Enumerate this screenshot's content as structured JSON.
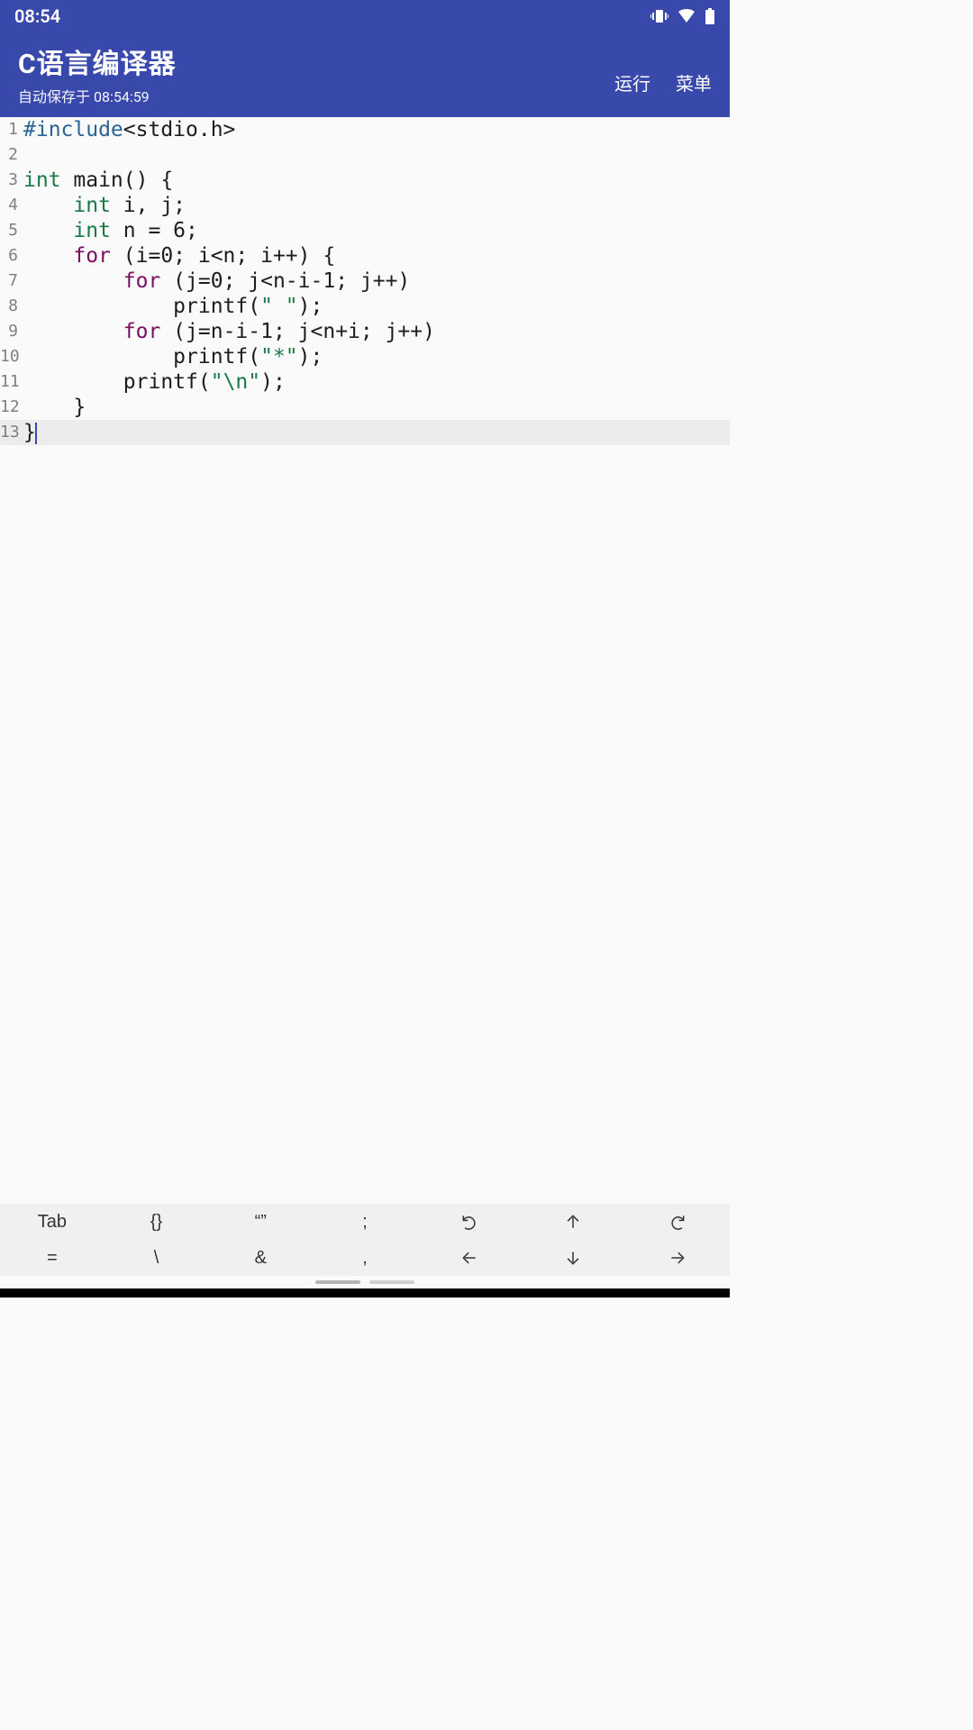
{
  "status": {
    "time": "08:54",
    "icons": [
      "vibrate-icon",
      "wifi-icon",
      "battery-icon"
    ]
  },
  "appbar": {
    "title": "C语言编译器",
    "subtitle": "自动保存于 08:54:59",
    "run_label": "运行",
    "menu_label": "菜单"
  },
  "editor": {
    "current_line": 13,
    "lines": [
      {
        "n": 1,
        "tokens": [
          [
            "pre",
            "#include"
          ],
          [
            "plain",
            "<stdio.h>"
          ]
        ]
      },
      {
        "n": 2,
        "tokens": []
      },
      {
        "n": 3,
        "tokens": [
          [
            "kw",
            "int"
          ],
          [
            "plain",
            " main() {"
          ]
        ]
      },
      {
        "n": 4,
        "tokens": [
          [
            "plain",
            "    "
          ],
          [
            "kw",
            "int"
          ],
          [
            "plain",
            " i, j;"
          ]
        ]
      },
      {
        "n": 5,
        "tokens": [
          [
            "plain",
            "    "
          ],
          [
            "kw",
            "int"
          ],
          [
            "plain",
            " n = 6;"
          ]
        ]
      },
      {
        "n": 6,
        "tokens": [
          [
            "plain",
            "    "
          ],
          [
            "ctrl",
            "for"
          ],
          [
            "plain",
            " (i=0; i<n; i++) {"
          ]
        ]
      },
      {
        "n": 7,
        "tokens": [
          [
            "plain",
            "        "
          ],
          [
            "ctrl",
            "for"
          ],
          [
            "plain",
            " (j=0; j<n-i-1; j++)"
          ]
        ]
      },
      {
        "n": 8,
        "tokens": [
          [
            "plain",
            "            printf("
          ],
          [
            "str",
            "\" \""
          ],
          [
            "plain",
            ");"
          ]
        ]
      },
      {
        "n": 9,
        "tokens": [
          [
            "plain",
            "        "
          ],
          [
            "ctrl",
            "for"
          ],
          [
            "plain",
            " (j=n-i-1; j<n+i; j++)"
          ]
        ]
      },
      {
        "n": 10,
        "tokens": [
          [
            "plain",
            "            printf("
          ],
          [
            "str",
            "\"*\""
          ],
          [
            "plain",
            ");"
          ]
        ]
      },
      {
        "n": 11,
        "tokens": [
          [
            "plain",
            "        printf("
          ],
          [
            "str",
            "\"\\n\""
          ],
          [
            "plain",
            ");"
          ]
        ]
      },
      {
        "n": 12,
        "tokens": [
          [
            "plain",
            "    }"
          ]
        ]
      },
      {
        "n": 13,
        "tokens": [
          [
            "plain",
            "}"
          ]
        ]
      }
    ]
  },
  "toolbar": {
    "row1": [
      "Tab",
      "{}",
      "“”",
      ";",
      "undo-icon",
      "arrow-up-icon",
      "redo-icon"
    ],
    "row2": [
      "=",
      "\\",
      "&",
      ",",
      "arrow-left-icon",
      "arrow-down-icon",
      "arrow-right-icon"
    ]
  }
}
